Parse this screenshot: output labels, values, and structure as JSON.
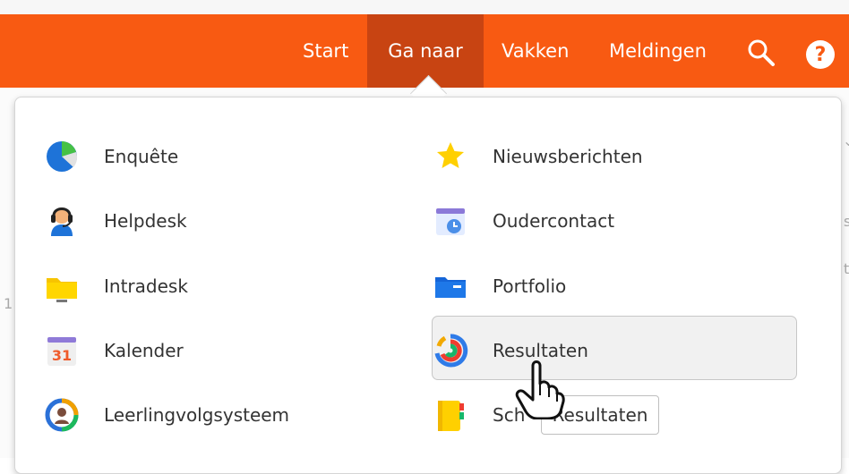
{
  "header": {
    "nav": [
      {
        "label": "Start"
      },
      {
        "label": "Ga naar"
      },
      {
        "label": "Vakken"
      },
      {
        "label": "Meldingen"
      }
    ],
    "icons": {
      "search": "search-icon",
      "help": "help-icon"
    },
    "colors": {
      "bar": "#f85a12",
      "active": "#c84412"
    }
  },
  "dropdown": {
    "left": [
      {
        "label": "Enquête",
        "icon": "pie-chart-icon"
      },
      {
        "label": "Helpdesk",
        "icon": "headset-user-icon"
      },
      {
        "label": "Intradesk",
        "icon": "folder-icon"
      },
      {
        "label": "Kalender",
        "icon": "calendar-icon",
        "icon_text": "31"
      },
      {
        "label": "Leerlingvolgsysteem",
        "icon": "student-ring-icon"
      }
    ],
    "right": [
      {
        "label": "Nieuwsberichten",
        "icon": "star-icon"
      },
      {
        "label": "Oudercontact",
        "icon": "calendar-clock-icon"
      },
      {
        "label": "Portfolio",
        "icon": "blue-folder-icon"
      },
      {
        "label": "Resultaten",
        "icon": "results-ring-icon"
      },
      {
        "label": "Sch",
        "icon": "notebook-icon"
      }
    ],
    "tooltip": "Resultaten"
  }
}
